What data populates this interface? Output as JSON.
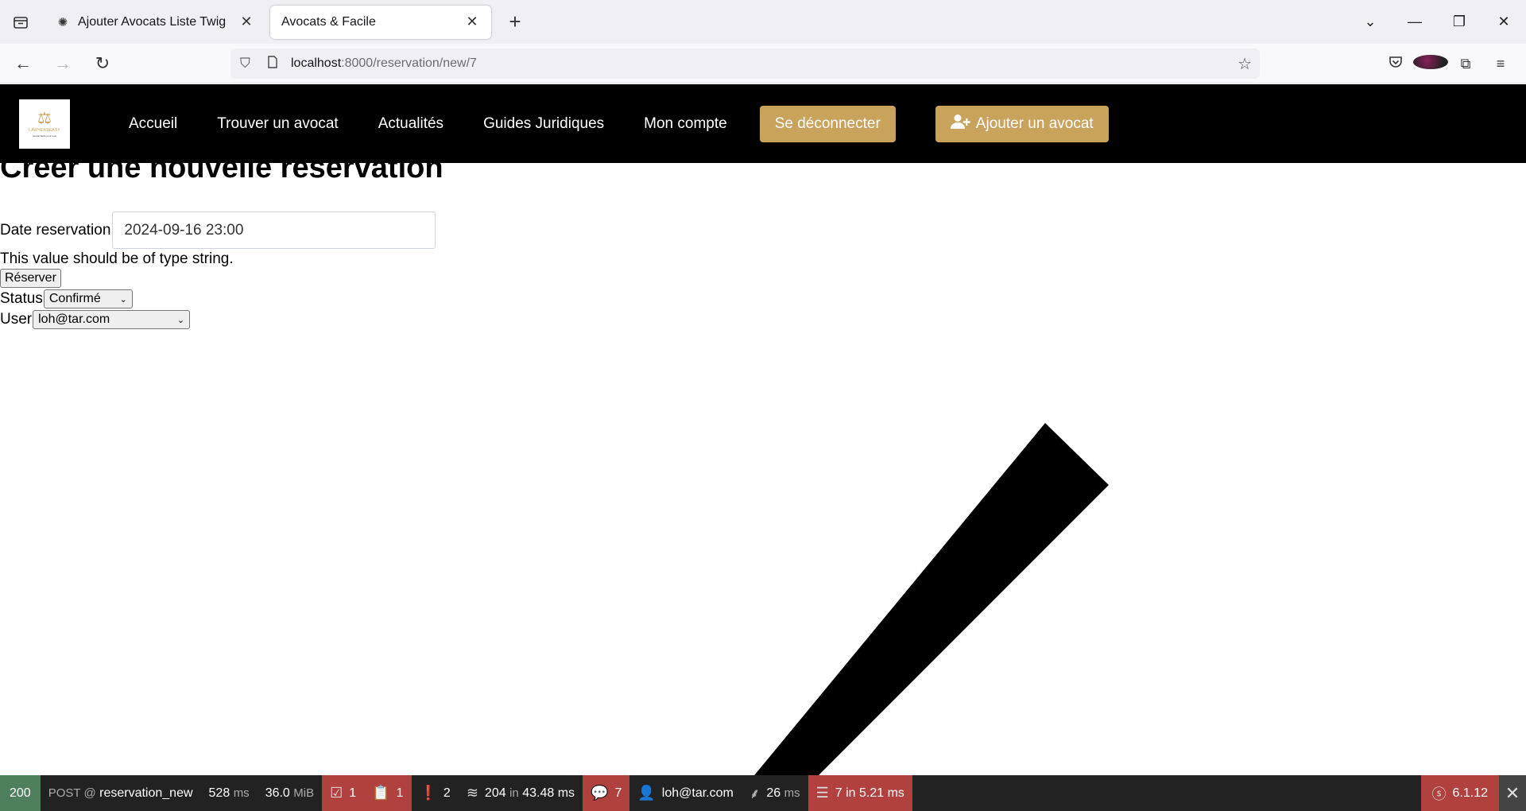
{
  "browser": {
    "tabs": [
      {
        "title": "Ajouter Avocats Liste Twig",
        "active": false,
        "favicon": "openai-icon"
      },
      {
        "title": "Avocats & Facile",
        "active": true
      }
    ],
    "url_host": "localhost",
    "url_path": ":8000/reservation/new/7"
  },
  "site": {
    "logo": {
      "brand": "LAWYERSEASY",
      "tagline": "avocat facile pour tous"
    },
    "menu": [
      "Accueil",
      "Trouver un avocat",
      "Actualités",
      "Guides Juridiques",
      "Mon compte"
    ],
    "logout_label": "Se déconnecter",
    "add_lawyer_label": "Ajouter un avocat"
  },
  "form": {
    "title": "Créer une nouvelle réservation",
    "date_label": "Date reservation",
    "date_value": "2024-09-16 23:00",
    "error": "This value should be of type string.",
    "submit_label": "Réserver",
    "status_label": "Status",
    "status_value": "Confirmé",
    "user_label": "User",
    "user_value": "loh@tar.com"
  },
  "debug_toolbar": {
    "status_code": "200",
    "method": "POST @",
    "route": "reservation_new",
    "time": "528",
    "time_unit": "ms",
    "memory": "36.0",
    "memory_unit": "MiB",
    "forms": "1",
    "logs": "1",
    "notices": "2",
    "cache_count": "204",
    "cache_in": "in",
    "cache_time": "43.48 ms",
    "translations": "7",
    "user": "loh@tar.com",
    "twig_time": "26",
    "twig_unit": "ms",
    "db": "7 in 5.21 ms",
    "symfony_version": "6.1.12"
  },
  "colors": {
    "accent_gold": "#c9a25b",
    "toolbar_red": "#b0413e",
    "status_green": "#4f805d"
  }
}
